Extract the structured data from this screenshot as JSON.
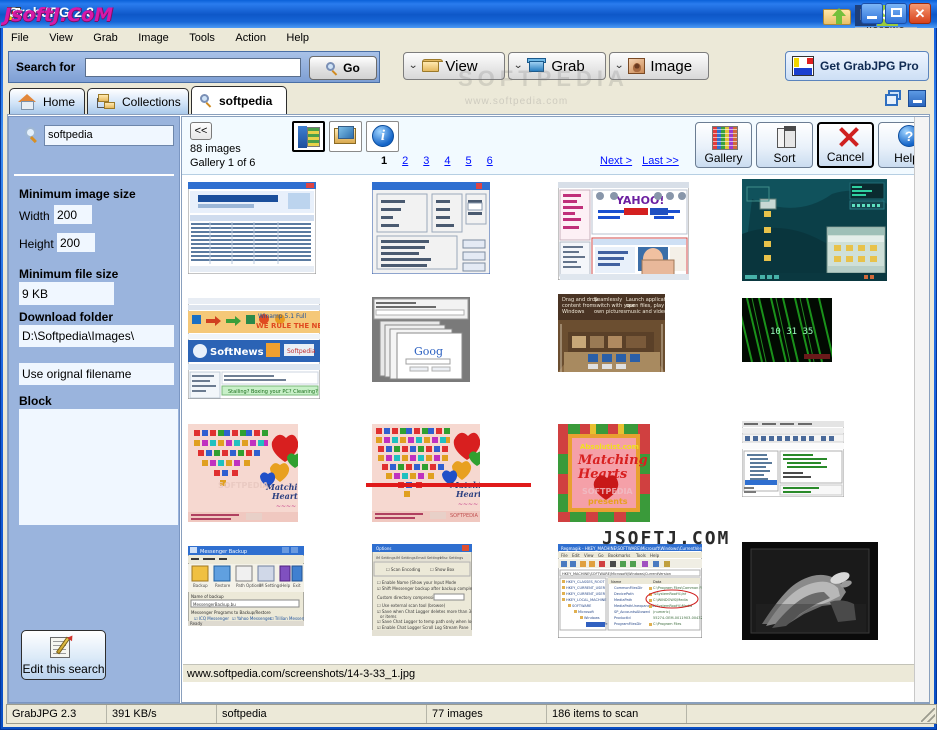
{
  "window": {
    "title": "GrabJPG 2.3",
    "watermark_title": "JsoftJ.CoM",
    "watermark_soft": "SOFTPEDIA",
    "watermark_soft_sub": "www.softpedia.com",
    "watermark_thumbs": "JSOFTJ.COM",
    "ns_n": "N",
    "ns_s": "S",
    "ns_host": "HOSTING",
    "minimize_label": "Minimize",
    "maximize_label": "Maximize",
    "close_label": "Close"
  },
  "menu": {
    "items": [
      "File",
      "View",
      "Grab",
      "Image",
      "Tools",
      "Action",
      "Help"
    ]
  },
  "toolbar": {
    "search_label": "Search for",
    "search_value": "",
    "search_placeholder": "",
    "go_label": "Go",
    "view_label": "View",
    "grab_label": "Grab",
    "image_label": "Image",
    "get_pro_label": "Get GrabJPG Pro"
  },
  "tabs": [
    {
      "label": "Home",
      "icon": "home-icon",
      "active": false
    },
    {
      "label": "Collections",
      "icon": "collections-icon",
      "active": false
    },
    {
      "label": "softpedia",
      "icon": "search-icon",
      "active": true
    }
  ],
  "sidebar": {
    "search_value": "softpedia",
    "min_image_size_label": "Minimum image size",
    "width_label": "Width",
    "width_value": "200",
    "height_label": "Height",
    "height_value": "200",
    "min_file_size_label": "Minimum file size",
    "min_file_size_value": "9 KB",
    "download_folder_label": "Download folder",
    "download_folder_value": "D:\\Softpedia\\Images\\",
    "filename_option_value": "Use orignal filename",
    "block_label": "Block",
    "block_value": "",
    "edit_search_label": "Edit this search"
  },
  "gallery": {
    "back_label": "<<",
    "image_count": "88 images",
    "gallery_of": "Gallery 1 of 6",
    "view_mode_slideshow": "slideshow-icon",
    "view_mode_catalog": "catalog-icon",
    "view_mode_info": "info-icon",
    "pages": [
      "1",
      "2",
      "3",
      "4",
      "5",
      "6"
    ],
    "current_page": "1",
    "next_label": "Next >",
    "last_label": "Last >>",
    "buttons": [
      {
        "label": "Gallery",
        "icon": "mosaic-icon"
      },
      {
        "label": "Sort",
        "icon": "sort-icon"
      },
      {
        "label": "Cancel",
        "icon": "cancel-icon"
      },
      {
        "label": "Help",
        "icon": "help-icon"
      }
    ],
    "status_url": "www.softpedia.com/screenshots/14-3-33_1.jpg"
  },
  "statusbar": {
    "cells": [
      "GrabJPG 2.3",
      "391 KB/s",
      "softpedia",
      "77 images",
      "186 items to scan",
      ""
    ]
  }
}
